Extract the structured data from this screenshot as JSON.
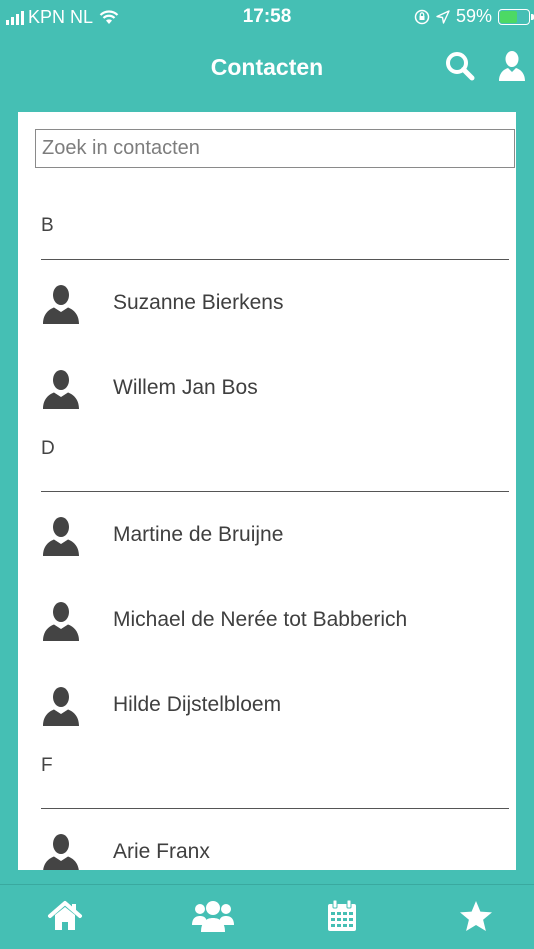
{
  "status_bar": {
    "carrier": "KPN NL",
    "time": "17:58",
    "battery_percent": "59%",
    "battery_level": 0.59
  },
  "header": {
    "title": "Contacten"
  },
  "search": {
    "placeholder": "Zoek in contacten"
  },
  "sections": [
    {
      "letter": "B",
      "contacts": [
        "Suzanne Bierkens",
        "Willem Jan Bos"
      ]
    },
    {
      "letter": "D",
      "contacts": [
        "Martine de Bruijne",
        "Michael de Nerée tot Babberich",
        "Hilde Dijstelbloem"
      ]
    },
    {
      "letter": "F",
      "contacts": [
        "Arie Franx"
      ]
    }
  ],
  "tabs": [
    "home-icon",
    "contacts-icon",
    "calendar-icon",
    "favorites-icon"
  ],
  "colors": {
    "brand": "#45bfb4",
    "icon_gray": "#444444",
    "battery_green": "#4cd964"
  }
}
